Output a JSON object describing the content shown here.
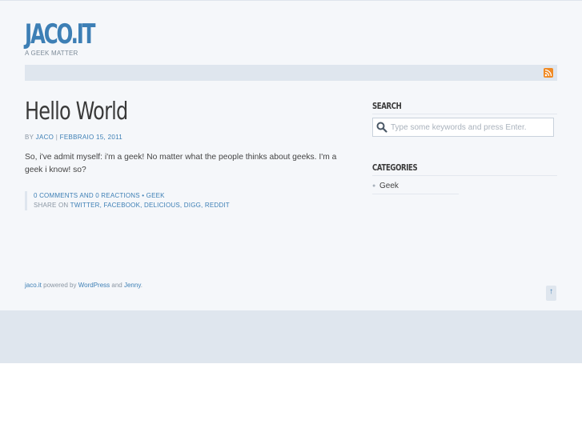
{
  "header": {
    "logo": "JACO.IT",
    "tagline": "A GEEK MATTER"
  },
  "icons": {
    "rss": "rss-icon",
    "search": "search-icon",
    "back_to_top": "arrow-up-icon"
  },
  "post": {
    "title": "Hello World",
    "meta_by": "BY",
    "meta_author": "JACO",
    "meta_separator": "|",
    "meta_date": "FEBBRAIO 15, 2011",
    "body": "So, i've admit myself: i'm a geek! No matter what the people thinks about geeks. I'm a geek i know! so?",
    "comments_link": "0 COMMENTS AND 0 REACTIONS",
    "category_separator": "•",
    "category_link": "GEEK",
    "share_label": "SHARE ON",
    "share_links": [
      "TWITTER",
      "FACEBOOK",
      "DELICIOUS",
      "DIGG",
      "REDDIT"
    ]
  },
  "sidebar": {
    "search_heading": "SEARCH",
    "search_placeholder": "Type some keywords and press Enter.",
    "search_value": "",
    "categories_heading": "CATEGORIES",
    "categories": [
      "Geek"
    ]
  },
  "footer": {
    "site_link": "jaco.it",
    "powered_text": "powered by",
    "wordpress_link": "WordPress",
    "and_text": "and",
    "theme_link": "Jenny",
    "period": ".",
    "top_button": "↑"
  },
  "colors": {
    "accent": "#3d7fb5",
    "page_bg": "#f5f7fa",
    "band_bg": "#dfe6ee",
    "rss": "#f08a24"
  }
}
